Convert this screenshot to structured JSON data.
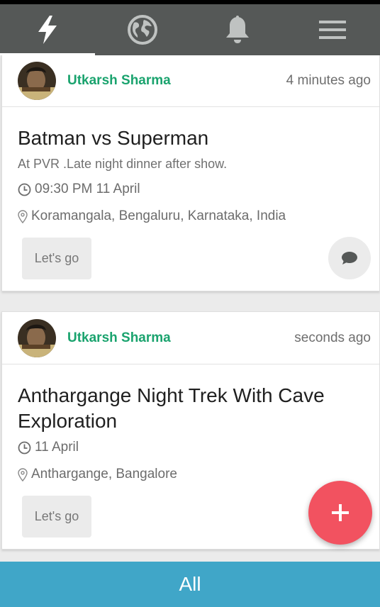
{
  "nav": {
    "tabs": [
      {
        "icon": "lightning-icon",
        "active": true
      },
      {
        "icon": "globe-icon",
        "active": false
      },
      {
        "icon": "bell-icon",
        "active": false
      },
      {
        "icon": "menu-icon",
        "active": false
      }
    ]
  },
  "posts": [
    {
      "author": "Utkarsh Sharma",
      "time": "4 minutes ago",
      "title": "Batman vs Superman",
      "description": "At PVR .Late night dinner after show.",
      "datetime": "09:30 PM 11 April",
      "location": "Koramangala, Bengaluru, Karnataka, India",
      "action_label": "Let's go"
    },
    {
      "author": "Utkarsh Sharma",
      "time": "seconds ago",
      "title": "Anthargange Night Trek With Cave Exploration",
      "datetime": "11 April",
      "location": "Anthargange, Bangalore",
      "action_label": "Let's go"
    }
  ],
  "fab": {
    "icon": "plus-icon"
  },
  "filter": {
    "label": "All"
  },
  "colors": {
    "topbar": "#555857",
    "author": "#1aa36e",
    "fab": "#f25260",
    "bottombar": "#40a6c8"
  }
}
